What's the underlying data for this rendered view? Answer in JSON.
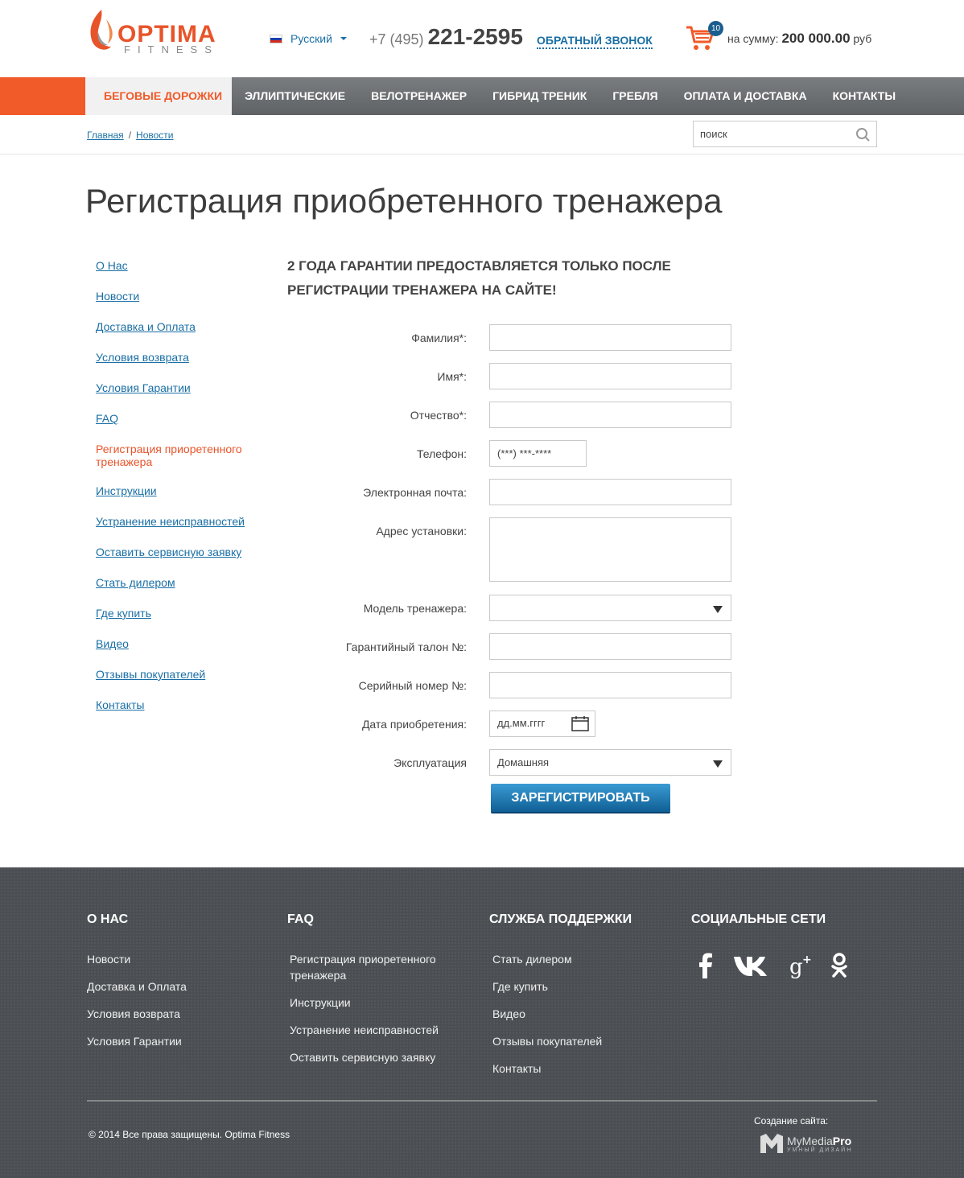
{
  "header": {
    "logo_title": "OPTIMA",
    "logo_sub": "FITNESS",
    "language": "Русский",
    "phone_prefix": "+7 (495)",
    "phone_number": "221-2595",
    "callback": "ОБРАТНЫЙ ЗВОНОК",
    "cart_count": "10",
    "cart_sum_label": "на сумму:",
    "cart_sum_value": "200 000.00",
    "cart_currency": "руб"
  },
  "nav": {
    "items": [
      {
        "label": "БЕГОВЫЕ ДОРОЖКИ"
      },
      {
        "label": "ЭЛЛИПТИЧЕСКИЕ"
      },
      {
        "label": "ВЕЛОТРЕНАЖЕР"
      },
      {
        "label": "ГИБРИД ТРЕНИК"
      },
      {
        "label": "ГРЕБЛЯ"
      },
      {
        "label": "ОПЛАТА И ДОСТАВКА"
      },
      {
        "label": "КОНТАКТЫ"
      }
    ]
  },
  "breadcrumb": {
    "home": "Главная",
    "separator": "/",
    "current": "Новости"
  },
  "search": {
    "placeholder": "поиск"
  },
  "page": {
    "title": "Регистрация приобретенного тренажера",
    "notice_line1": "2 ГОДА ГАРАНТИИ ПРЕДОСТАВЛЯЕТСЯ ТОЛЬКО ПОСЛЕ",
    "notice_line2": "РЕГИСТРАЦИИ ТРЕНАЖЕРА НА САЙТЕ!"
  },
  "sidebar": {
    "items": [
      {
        "label": "О Нас"
      },
      {
        "label": "Новости"
      },
      {
        "label": "Доставка и Оплата"
      },
      {
        "label": "Условия возврата"
      },
      {
        "label": "Условия Гарантии"
      },
      {
        "label": "FAQ"
      },
      {
        "label": "Регистрация приоретенного тренажера"
      },
      {
        "label": "Инструкции"
      },
      {
        "label": "Устранение неисправностей"
      },
      {
        "label": "Оставить сервисную заявку"
      },
      {
        "label": "Стать дилером"
      },
      {
        "label": "Где купить"
      },
      {
        "label": "Видео"
      },
      {
        "label": "Отзывы покупателей"
      },
      {
        "label": "Контакты"
      }
    ]
  },
  "form": {
    "surname_label": "Фамилия*:",
    "name_label": "Имя*:",
    "patronymic_label": "Отчество*:",
    "phone_label": "Телефон:",
    "phone_mask": "(***) ***-****",
    "email_label": "Электронная почта:",
    "address_label": "Адрес установки:",
    "model_label": "Модель тренажера:",
    "warranty_label": "Гарантийный талон №:",
    "serial_label": "Серийный номер №:",
    "date_label": "Дата приобретения:",
    "date_placeholder": "дд.мм.гггг",
    "usage_label": "Эксплуатация",
    "usage_value": "Домашняя",
    "submit": "ЗАРЕГИСТРИРОВАТЬ"
  },
  "footer": {
    "col1": {
      "title": "О НАС",
      "links": [
        "Новости",
        "Доставка и Оплата",
        "Условия возврата",
        "Условия Гарантии"
      ]
    },
    "col2": {
      "title": "FAQ",
      "links": [
        "Регистрация приоретенного тренажера",
        "Инструкции",
        "Устранение неисправностей",
        "Оставить сервисную заявку"
      ]
    },
    "col3": {
      "title": "СЛУЖБА ПОДДЕРЖКИ",
      "links": [
        "Стать дилером",
        "Где купить",
        "Видео",
        "Отзывы покупателей",
        "Контакты"
      ]
    },
    "col4": {
      "title": "СОЦИАЛЬНЫЕ СЕТИ",
      "icons": [
        "facebook-icon",
        "vk-icon",
        "google-plus-icon",
        "odnoklassniki-icon"
      ]
    },
    "copyright": "© 2014 Все права защищены. Optima Fitness",
    "made_by": "Создание сайта:",
    "studio_name_a": "MyMedia",
    "studio_name_b": "Pro",
    "studio_tagline": "УМНЫЙ ДИЗАЙН"
  },
  "colors": {
    "accent": "#f15a29",
    "link": "#1a6fa5",
    "nav_bg": "#6a6d70",
    "footer_bg": "#4b4f53",
    "button": "#1673b1"
  }
}
